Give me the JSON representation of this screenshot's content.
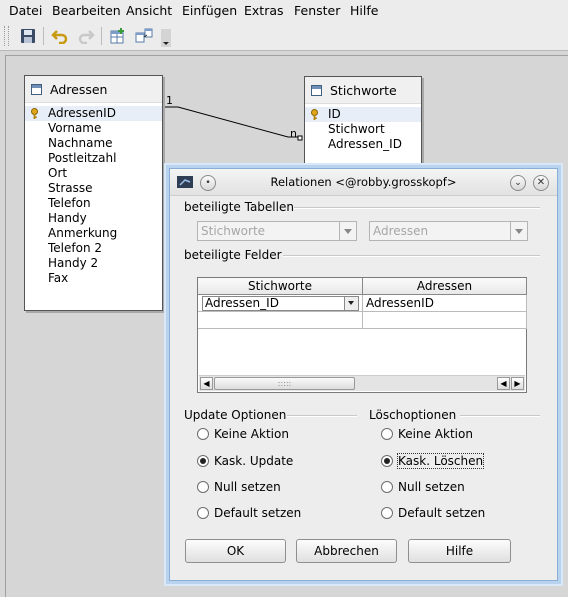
{
  "menu": [
    "Datei",
    "Bearbeiten",
    "Ansicht",
    "Einfügen",
    "Extras",
    "Fenster",
    "Hilfe"
  ],
  "tables": {
    "adressen": {
      "title": "Adressen",
      "fields": [
        "AdressenID",
        "Vorname",
        "Nachname",
        "Postleitzahl",
        "Ort",
        "Strasse",
        "Telefon",
        "Handy",
        "Anmerkung",
        "Telefon 2",
        "Handy 2",
        "Fax"
      ]
    },
    "stichworte": {
      "title": "Stichworte",
      "fields": [
        "ID",
        "Stichwort",
        "Adressen_ID"
      ]
    }
  },
  "relation": {
    "left_card": "1",
    "right_card": "n"
  },
  "dialog": {
    "title": "Relationen <@robby.grosskopf>",
    "tables_label": "beteiligte Tabellen",
    "table_left": "Stichworte",
    "table_right": "Adressen",
    "fields_label": "beteiligte Felder",
    "grid_headers": [
      "Stichworte",
      "Adressen"
    ],
    "grid_row": {
      "left": "Adressen_ID",
      "right": "AdressenID"
    },
    "update_label": "Update Optionen",
    "update_options": [
      "Keine Aktion",
      "Kask. Update",
      "Null setzen",
      "Default setzen"
    ],
    "update_selected": 1,
    "delete_label": "Löschoptionen",
    "delete_options": [
      "Keine Aktion",
      "Kask. Löschen",
      "Null setzen",
      "Default setzen"
    ],
    "delete_selected": 1,
    "ok": "OK",
    "cancel": "Abbrechen",
    "help": "Hilfe"
  }
}
